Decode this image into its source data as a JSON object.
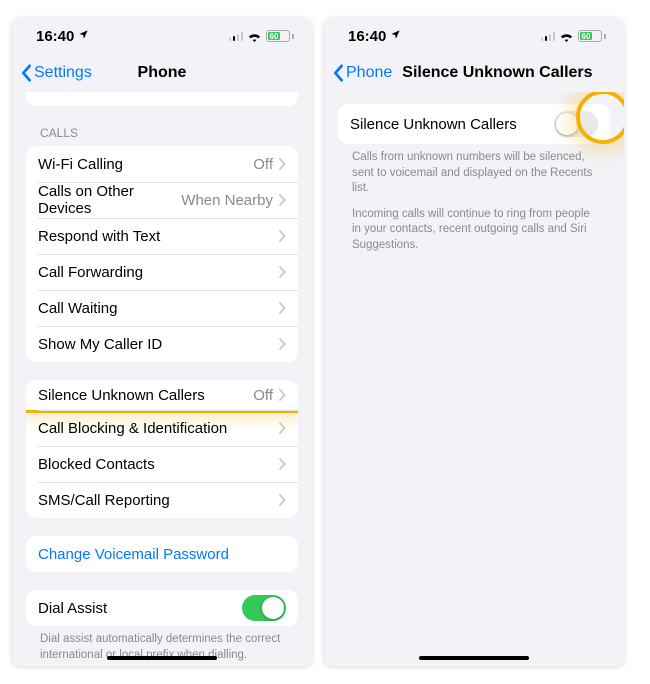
{
  "status": {
    "time": "16:40",
    "battery_text": "60"
  },
  "left_screen": {
    "back_label": "Settings",
    "title": "Phone",
    "calls_header": "CALLS",
    "rows": {
      "wifi_calling": {
        "label": "Wi-Fi Calling",
        "value": "Off"
      },
      "other_devices": {
        "label": "Calls on Other Devices",
        "value": "When Nearby"
      },
      "respond_text": {
        "label": "Respond with Text"
      },
      "call_forwarding": {
        "label": "Call Forwarding"
      },
      "call_waiting": {
        "label": "Call Waiting"
      },
      "show_caller_id": {
        "label": "Show My Caller ID"
      },
      "silence_unknown": {
        "label": "Silence Unknown Callers",
        "value": "Off"
      },
      "call_blocking": {
        "label": "Call Blocking & Identification"
      },
      "blocked_contacts": {
        "label": "Blocked Contacts"
      },
      "sms_reporting": {
        "label": "SMS/Call Reporting"
      }
    },
    "voicemail_link": "Change Voicemail Password",
    "dial_assist_label": "Dial Assist",
    "dial_assist_footer": "Dial assist automatically determines the correct international or local prefix when dialling."
  },
  "right_screen": {
    "back_label": "Phone",
    "title": "Silence Unknown Callers",
    "row_label": "Silence Unknown Callers",
    "footer_1": "Calls from unknown numbers will be silenced, sent to voicemail and displayed on the Recents list.",
    "footer_2": "Incoming calls will continue to ring from people in your contacts, recent outgoing calls and Siri Suggestions."
  }
}
